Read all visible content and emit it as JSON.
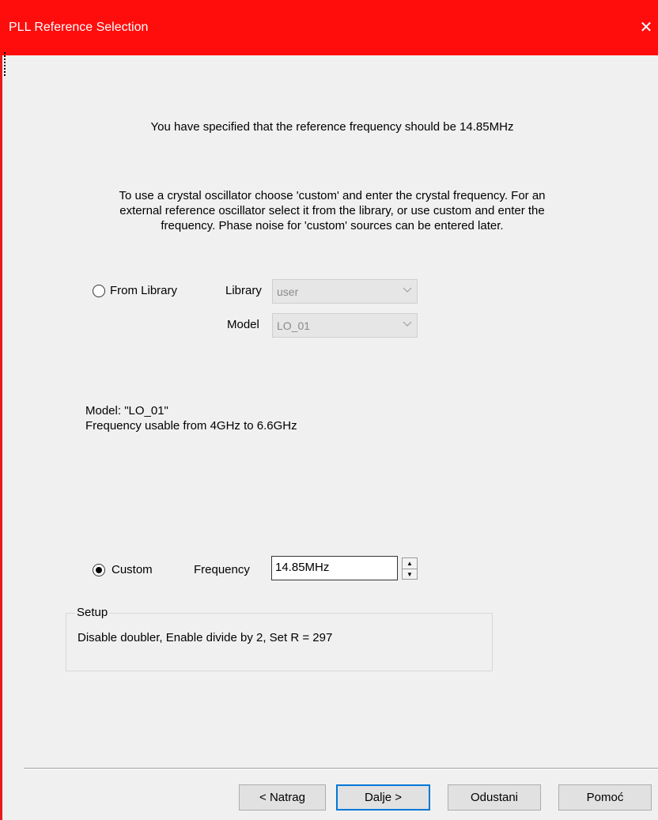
{
  "window": {
    "title": "PLL Reference Selection",
    "close_glyph": "✕"
  },
  "intro": {
    "line": "You have specified that the reference frequency should be 14.85MHz",
    "instructions": [
      "To use a crystal oscillator choose 'custom' and enter the crystal frequency.  For an",
      "external reference oscillator select it from the library,  or use custom and enter the",
      "frequency.  Phase noise for 'custom' sources can be entered later."
    ]
  },
  "from_library": {
    "label": "From Library",
    "selected": false,
    "library_label": "Library",
    "library_value": "user",
    "model_label": "Model",
    "model_value": "LO_01",
    "enabled": false
  },
  "model_info": {
    "name_line": "Model: \"LO_01\"",
    "range_line": "Frequency usable from  4GHz to 6.6GHz"
  },
  "custom": {
    "label": "Custom",
    "selected": true,
    "frequency_label": "Frequency",
    "frequency_value": "14.85MHz",
    "spin_up": "▲",
    "spin_down": "▼"
  },
  "setup": {
    "legend": "Setup",
    "text": "Disable doubler, Enable divide by 2,  Set R = 297"
  },
  "buttons": {
    "back": "< Natrag",
    "next": "Dalje >",
    "cancel": "Odustani",
    "help": "Pomoć"
  },
  "colors": {
    "title_bar": "#ff0d0d",
    "default_button_border": "#0078d7"
  },
  "icons": {
    "close": "close-icon",
    "chevron": "chevron-down-icon"
  }
}
